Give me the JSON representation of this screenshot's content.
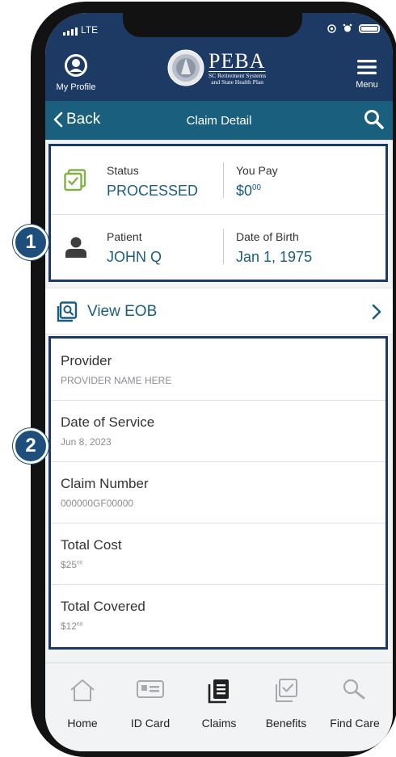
{
  "status_bar": {
    "network": "LTE"
  },
  "header": {
    "profile_label": "My Profile",
    "logo_name": "PEBA",
    "logo_sub_line1": "SC Retirement Systems",
    "logo_sub_line2": "and State Health Plan",
    "menu_label": "Menu"
  },
  "nav": {
    "back_label": "Back",
    "title": "Claim Detail"
  },
  "summary": {
    "status_label": "Status",
    "status_value": "PROCESSED",
    "you_pay_label": "You Pay",
    "you_pay_dollars": "$0",
    "you_pay_cents": "00",
    "patient_label": "Patient",
    "patient_value": "JOHN Q",
    "dob_label": "Date of Birth",
    "dob_value": "Jan 1, 1975"
  },
  "eob": {
    "label": "View EOB"
  },
  "details": {
    "provider_label": "Provider",
    "provider_value": "PROVIDER NAME HERE",
    "dos_label": "Date of Service",
    "dos_value": "Jun 8, 2023",
    "claim_label": "Claim Number",
    "claim_value": "000000GF00000",
    "total_cost_label": "Total Cost",
    "total_cost_dollars": "$25",
    "total_cost_cents": "00",
    "total_covered_label": "Total Covered",
    "total_covered_dollars": "$12",
    "total_covered_cents": "66"
  },
  "tabs": {
    "home": "Home",
    "id_card": "ID Card",
    "claims": "Claims",
    "benefits": "Benefits",
    "find_care": "Find Care"
  },
  "callouts": {
    "one": "1",
    "two": "2"
  },
  "colors": {
    "header_navy": "#1d3a64",
    "nav_teal": "#1a5f7e",
    "accent_blue": "#1b5d80",
    "status_green": "#7fb241",
    "callout_blue": "#1d4e7c"
  }
}
